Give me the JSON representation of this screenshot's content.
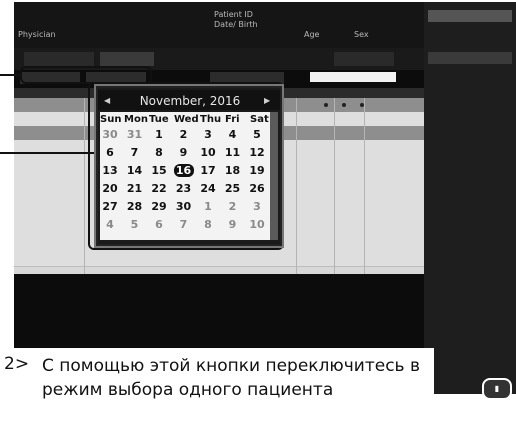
{
  "header": {
    "physician_label": "Physician",
    "patient_id_label": "Patient ID",
    "date_birth_label": "Date/ Birth",
    "age_label": "Age",
    "sex_label": "Sex"
  },
  "calendar": {
    "title": "November, 2016",
    "weekdays": [
      "Sun",
      "Mon",
      "Tue",
      "Wed",
      "Thu",
      "Fri",
      "Sat"
    ],
    "weeks": [
      [
        "30",
        "31",
        "1",
        "2",
        "3",
        "4",
        "5"
      ],
      [
        "6",
        "7",
        "8",
        "9",
        "10",
        "11",
        "12"
      ],
      [
        "13",
        "14",
        "15",
        "16",
        "17",
        "18",
        "19"
      ],
      [
        "20",
        "21",
        "22",
        "23",
        "24",
        "25",
        "26"
      ],
      [
        "27",
        "28",
        "29",
        "30",
        "1",
        "2",
        "3"
      ],
      [
        "4",
        "5",
        "6",
        "7",
        "8",
        "9",
        "10"
      ]
    ],
    "selected_day": "16"
  },
  "caption": {
    "number": "2>",
    "text": "С помощью этой кнопки переключитесь в режим выбора одного пациента"
  },
  "colors": {
    "screen_bg": "#0c0c0c",
    "grid_bg": "#d8d8d8",
    "calendar_bg": "#f3f3f3"
  }
}
